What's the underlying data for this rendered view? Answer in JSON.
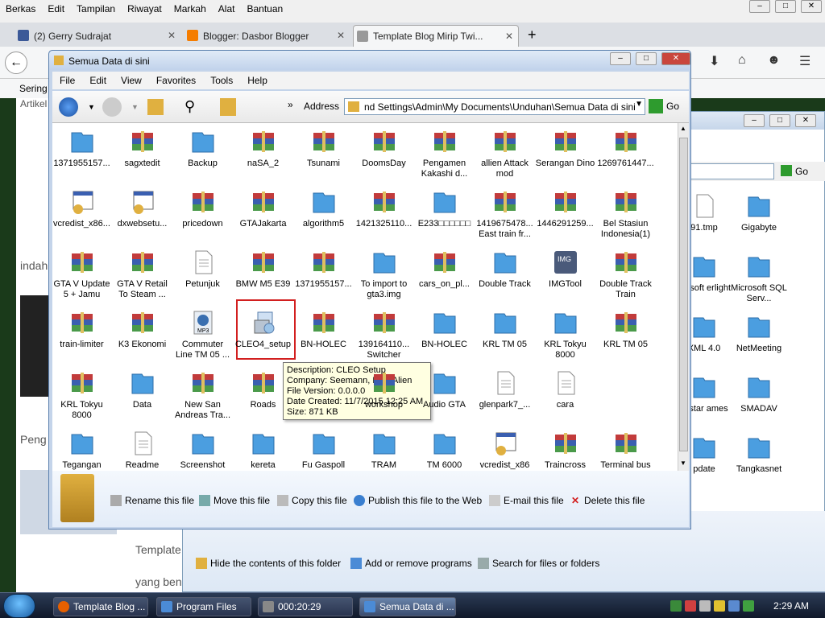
{
  "firefox": {
    "menu": [
      "Berkas",
      "Edit",
      "Tampilan",
      "Riwayat",
      "Markah",
      "Alat",
      "Bantuan"
    ],
    "tabs": [
      {
        "title": "(2) Gerry Sudrajat",
        "color": "#3b5998"
      },
      {
        "title": "Blogger: Dasbor Blogger",
        "color": "#f57d00"
      },
      {
        "title": "Template Blog Mirip Twi...",
        "color": "#999999"
      }
    ],
    "new_tab": "+",
    "bookmark_label": "Sering"
  },
  "page_bg": {
    "texts": [
      "Artikel",
      "indah",
      "Peng",
      "Template",
      "yang ben"
    ]
  },
  "window": {
    "title": "Semua Data di sini",
    "menu": [
      "File",
      "Edit",
      "View",
      "Favorites",
      "Tools",
      "Help"
    ],
    "address_label": "Address",
    "address_value": "nd Settings\\Admin\\My Documents\\Unduhan\\Semua Data di sini",
    "go_label": "Go",
    "items": [
      {
        "label": "1371955157...",
        "type": "folder"
      },
      {
        "label": "sagxtedit",
        "type": "rar"
      },
      {
        "label": "Backup",
        "type": "folder"
      },
      {
        "label": "naSA_2",
        "type": "rar"
      },
      {
        "label": "Tsunami",
        "type": "rar"
      },
      {
        "label": "DoomsDay",
        "type": "rar"
      },
      {
        "label": "Pengamen Kakashi d...",
        "type": "rar"
      },
      {
        "label": "allien Attack mod",
        "type": "rar"
      },
      {
        "label": "Serangan Dino",
        "type": "rar"
      },
      {
        "label": "1269761447...",
        "type": "rar"
      },
      {
        "label": "vcredist_x86...",
        "type": "exe"
      },
      {
        "label": "dxwebsetu...",
        "type": "exe"
      },
      {
        "label": "pricedown",
        "type": "rar"
      },
      {
        "label": "GTAJakarta",
        "type": "rar"
      },
      {
        "label": "algorithm5",
        "type": "folder"
      },
      {
        "label": "1421325110...",
        "type": "rar"
      },
      {
        "label": "E233□□□□□□",
        "type": "folder"
      },
      {
        "label": "1419675478... East train fr...",
        "type": "rar"
      },
      {
        "label": "1446291259...",
        "type": "rar"
      },
      {
        "label": "Bel Stasiun Indonesia(1)",
        "type": "rar"
      },
      {
        "label": "GTA V Update 5 + Jamu",
        "type": "rar"
      },
      {
        "label": "GTA V Retail To Steam ...",
        "type": "rar"
      },
      {
        "label": "Petunjuk",
        "type": "doc"
      },
      {
        "label": "BMW M5 E39",
        "type": "rar"
      },
      {
        "label": "1371955157...",
        "type": "rar"
      },
      {
        "label": "To import to gta3.img",
        "type": "folder"
      },
      {
        "label": "cars_on_pl...",
        "type": "rar"
      },
      {
        "label": "Double Track",
        "type": "folder"
      },
      {
        "label": "IMGTool",
        "type": "img"
      },
      {
        "label": "Double Track Train",
        "type": "rar"
      },
      {
        "label": "train-limiter",
        "type": "rar"
      },
      {
        "label": "K3 Ekonomi",
        "type": "rar"
      },
      {
        "label": "Commuter Line TM 05 ...",
        "type": "mp3"
      },
      {
        "label": "CLEO4_setup",
        "type": "setup"
      },
      {
        "label": "BN-HOLEC",
        "type": "rar"
      },
      {
        "label": "139164110... Switcher",
        "type": "rar"
      },
      {
        "label": "BN-HOLEC",
        "type": "folder"
      },
      {
        "label": "KRL TM 05",
        "type": "folder"
      },
      {
        "label": "KRL Tokyu 8000",
        "type": "folder"
      },
      {
        "label": "KRL TM 05",
        "type": "rar"
      },
      {
        "label": "KRL Tokyu 8000",
        "type": "rar"
      },
      {
        "label": "Data",
        "type": "folder"
      },
      {
        "label": "New San Andreas Tra...",
        "type": "rar"
      },
      {
        "label": "Roads",
        "type": "rar"
      },
      {
        "label": "",
        "type": "hidden"
      },
      {
        "label": "workshop",
        "type": "rar"
      },
      {
        "label": "Audio GTA",
        "type": "folder"
      },
      {
        "label": "glenpark7_...",
        "type": "doc"
      },
      {
        "label": "cara",
        "type": "doc"
      },
      {
        "label": "",
        "type": "hidden"
      },
      {
        "label": "Tegangan",
        "type": "folder"
      },
      {
        "label": "Readme",
        "type": "doc"
      },
      {
        "label": "Screenshot",
        "type": "folder"
      },
      {
        "label": "kereta",
        "type": "folder"
      },
      {
        "label": "Fu Gaspoll",
        "type": "folder"
      },
      {
        "label": "TRAM",
        "type": "folder"
      },
      {
        "label": "TM 6000",
        "type": "folder"
      },
      {
        "label": "vcredist_x86",
        "type": "exe"
      },
      {
        "label": "Traincross",
        "type": "rar"
      },
      {
        "label": "Terminal bus",
        "type": "rar"
      }
    ],
    "tooltip": [
      "Description: CLEO Setup",
      "Company: Seemann, Deji, Alien",
      "File Version: 0.0.0.0",
      "Date Created: 11/7/2015 12:25 AM",
      "Size: 871 KB"
    ],
    "tasks": [
      "Rename this file",
      "Move this file",
      "Copy this file",
      "Publish this file to the Web",
      "E-mail this file",
      "Delete this file"
    ]
  },
  "back_window": {
    "go_label": "Go",
    "items": [
      {
        "label": "91.tmp",
        "type": "file"
      },
      {
        "label": "Gigabyte",
        "type": "folder"
      },
      {
        "label": "crosoft erlight",
        "type": "folder"
      },
      {
        "label": "Microsoft SQL Serv...",
        "type": "folder"
      },
      {
        "label": "XML 4.0",
        "type": "folder"
      },
      {
        "label": "NetMeeting",
        "type": "folder"
      },
      {
        "label": "ckstar ames",
        "type": "folder"
      },
      {
        "label": "SMADAV",
        "type": "folder"
      },
      {
        "label": "pdate",
        "type": "folder"
      },
      {
        "label": "Tangkasnet",
        "type": "folder"
      }
    ],
    "tasks": [
      "Hide the contents of this folder",
      "Add or remove programs",
      "Search for files or folders"
    ]
  },
  "taskbar": {
    "buttons": [
      {
        "label": "Template Blog ...",
        "color": "#e66000"
      },
      {
        "label": "Program Files",
        "color": "#4b8bd6"
      },
      {
        "label": "000:20:29",
        "color": "#888888"
      },
      {
        "label": "Semua Data di ...",
        "color": "#4b8bd6",
        "active": true
      }
    ],
    "clock": "2:29 AM"
  },
  "colors": {
    "folder": "#4b9ee0",
    "rar_top": "#c23b3b",
    "selection": "#d21f1f",
    "tooltip_bg": "#ffffe1"
  }
}
